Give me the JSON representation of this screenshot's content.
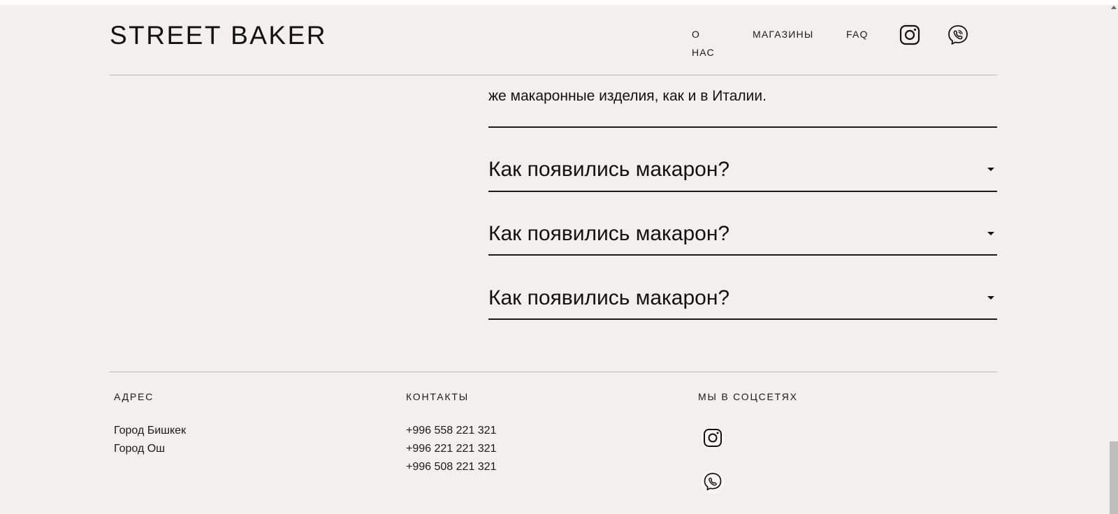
{
  "header": {
    "logo": "STREET BAKER",
    "nav": {
      "about": "О НАС",
      "shops": "МАГАЗИНЫ",
      "faq": "FAQ"
    },
    "icons": [
      "instagram-icon",
      "viber-icon"
    ]
  },
  "faq": {
    "open_answer_tail": "же макаронные изделия, как и в Италии.",
    "questions": [
      "Как появились макарон?",
      "Как появились макарон?",
      "Как появились макарон?"
    ]
  },
  "footer": {
    "address": {
      "title": "АДРЕС",
      "lines": [
        "Город Бишкек",
        "Город Ош"
      ]
    },
    "contacts": {
      "title": "КОНТАКТЫ",
      "phones": [
        "+996 558 221 321",
        "+996 221 221 321",
        "+996 508 221 321"
      ]
    },
    "social": {
      "title": "МЫ В СОЦСЕТЯХ",
      "icons": [
        "instagram-icon",
        "viber-icon"
      ]
    }
  },
  "colors": {
    "background": "#f1f0ed",
    "text": "#111111",
    "divider": "#b9b9b6"
  }
}
